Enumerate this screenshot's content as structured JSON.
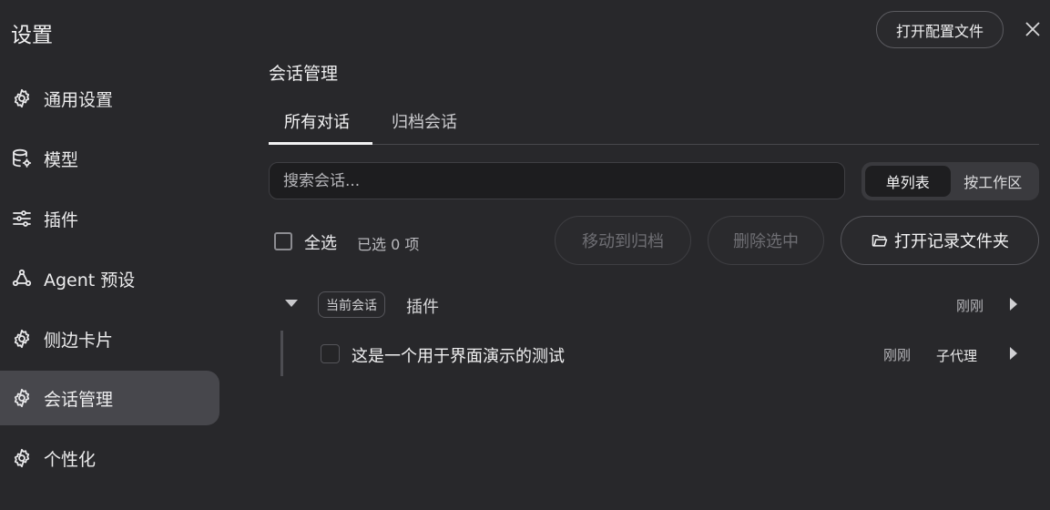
{
  "sidebar": {
    "title": "设置",
    "items": [
      {
        "label": "通用设置",
        "icon": "gear-icon"
      },
      {
        "label": "模型",
        "icon": "database-gear-icon"
      },
      {
        "label": "插件",
        "icon": "sliders-icon"
      },
      {
        "label": "Agent 预设",
        "icon": "agent-network-icon"
      },
      {
        "label": "侧边卡片",
        "icon": "gear-icon"
      },
      {
        "label": "会话管理",
        "icon": "gear-icon",
        "active": true
      },
      {
        "label": "个性化",
        "icon": "gear-icon"
      }
    ]
  },
  "header": {
    "open_config_label": "打开配置文件",
    "close_icon": "close-icon"
  },
  "main": {
    "section_title": "会话管理",
    "tabs": [
      {
        "label": "所有对话",
        "active": true
      },
      {
        "label": "归档会话",
        "active": false
      }
    ],
    "search_placeholder": "搜索会话...",
    "view_toggle": [
      {
        "label": "单列表",
        "selected": true
      },
      {
        "label": "按工作区",
        "selected": false
      }
    ],
    "select_all_label": "全选",
    "selected_count_label": "已选 0 项",
    "archive_button": "移动到归档",
    "delete_button": "删除选中",
    "open_folder_button": "打开记录文件夹",
    "group": {
      "badge": "当前会话",
      "name": "插件",
      "time": "刚刚",
      "children": [
        {
          "title": "这是一个用于界面演示的测试",
          "time": "刚刚",
          "tag": "子代理"
        }
      ]
    }
  },
  "colors": {
    "background": "#28282b",
    "active_nav": "#47474c",
    "search_bg": "#1d1d1f"
  }
}
